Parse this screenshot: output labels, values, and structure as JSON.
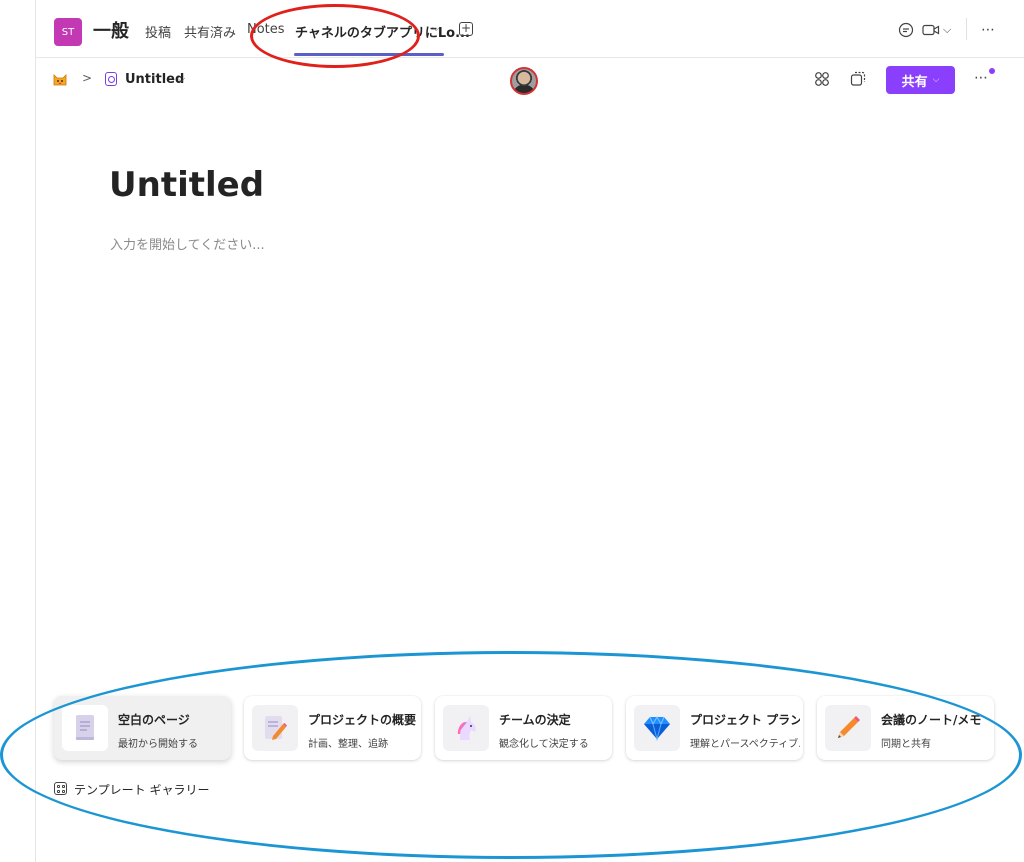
{
  "header": {
    "team_avatar": "ST",
    "channel_name": "一般",
    "tabs": [
      {
        "label": "投稿"
      },
      {
        "label": "共有済み"
      },
      {
        "label": "Notes"
      },
      {
        "label": "チャネルのタブアプリにLo..."
      }
    ],
    "icons": [
      "chat-icon",
      "video-icon",
      "chevron-down-icon",
      "more-icon"
    ]
  },
  "toolbar": {
    "breadcrumb_icon": "cat-icon",
    "page_title": "Untitled",
    "share_label": "共有",
    "accent": "#8a3ffc"
  },
  "document": {
    "title": "Untitled",
    "placeholder": "入力を開始してください..."
  },
  "templates": [
    {
      "title": "空白のページ",
      "desc": "最初から開始する",
      "icon": "blank-page-icon"
    },
    {
      "title": "プロジェクトの概要",
      "desc": "計画、整理、追跡",
      "icon": "note-pencil-icon"
    },
    {
      "title": "チームの決定",
      "desc": "観念化して決定する",
      "icon": "unicorn-icon"
    },
    {
      "title": "プロジェクト プランニング",
      "desc": "理解とパースペクティブ...",
      "icon": "diamond-icon"
    },
    {
      "title": "会議のノート/メモ",
      "desc": "同期と共有",
      "icon": "pencil-icon"
    }
  ],
  "gallery_label": "テンプレート ギャラリー",
  "annotations": {
    "red": "#e0201b",
    "blue": "#1b95d3"
  }
}
